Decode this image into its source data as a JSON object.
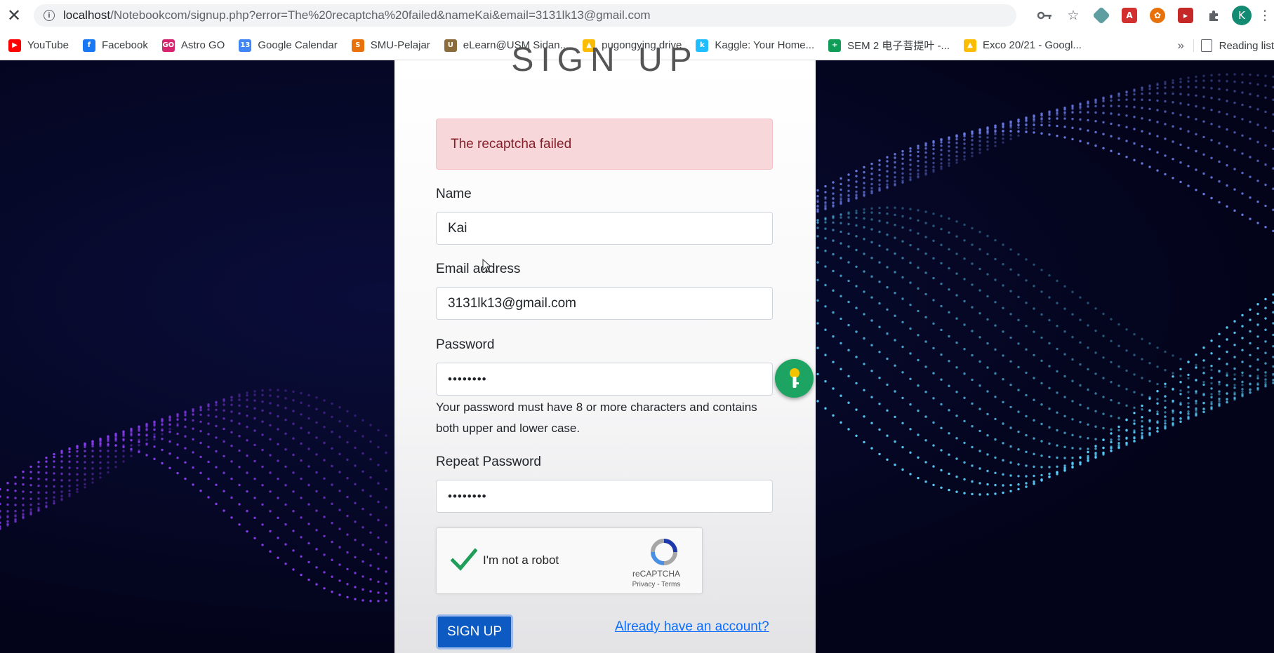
{
  "browser": {
    "url_host": "localhost",
    "url_rest": "/Notebookcom/signup.php?error=The%20recaptcha%20failed&nameKai&email=3131lk13@gmail.com",
    "avatar_letter": "K",
    "bookmarks_more": "»",
    "reading_list": "Reading list"
  },
  "bookmarks": [
    {
      "label": "YouTube",
      "icon": "youtube-icon",
      "color": "#ff0000",
      "glyph": "▶"
    },
    {
      "label": "Facebook",
      "icon": "facebook-icon",
      "color": "#1877f2",
      "glyph": "f"
    },
    {
      "label": "Astro GO",
      "icon": "astro-go-icon",
      "color": "#d6246e",
      "glyph": "GO"
    },
    {
      "label": "Google Calendar",
      "icon": "calendar-icon",
      "color": "#4285f4",
      "glyph": "13"
    },
    {
      "label": "SMU-Pelajar",
      "icon": "smu-icon",
      "color": "#e8710a",
      "glyph": "S"
    },
    {
      "label": "eLearn@USM Sidan...",
      "icon": "usm-crest-icon",
      "color": "#8a6d3b",
      "glyph": "U"
    },
    {
      "label": "pugongying drive",
      "icon": "google-drive-icon",
      "color": "#fbbc04",
      "glyph": "▲"
    },
    {
      "label": "Kaggle: Your Home...",
      "icon": "kaggle-icon",
      "color": "#20beff",
      "glyph": "k"
    },
    {
      "label": "SEM 2 电子菩提叶 -...",
      "icon": "google-sheets-icon",
      "color": "#0f9d58",
      "glyph": "+"
    },
    {
      "label": "Exco 20/21 - Googl...",
      "icon": "google-drive-icon",
      "color": "#fbbc04",
      "glyph": "▲"
    }
  ],
  "form": {
    "heading": "SIGN UP",
    "alert": "The recaptcha failed",
    "name_label": "Name",
    "name_value": "Kai",
    "email_label": "Email address",
    "email_value": "3131lk13@gmail.com",
    "password_label": "Password",
    "password_value": "••••••••",
    "password_help": "Your password must have 8 or more characters and contains both upper and lower case.",
    "repeat_label": "Repeat Password",
    "repeat_value": "••••••••",
    "captcha_label": "I'm not a robot",
    "captcha_brand": "reCAPTCHA",
    "captcha_links": "Privacy - Terms",
    "submit_label": "SIGN UP",
    "login_link": "Already have an account?"
  },
  "colors": {
    "alert_bg": "#f8d7da",
    "alert_text": "#842029",
    "primary": "#0d5ac3",
    "link": "#0d6efd",
    "checkmark": "#1e9e58",
    "background_dark": "#05061c",
    "wave_purple": "#8a3cf0",
    "wave_cyan": "#5ad2ff"
  }
}
